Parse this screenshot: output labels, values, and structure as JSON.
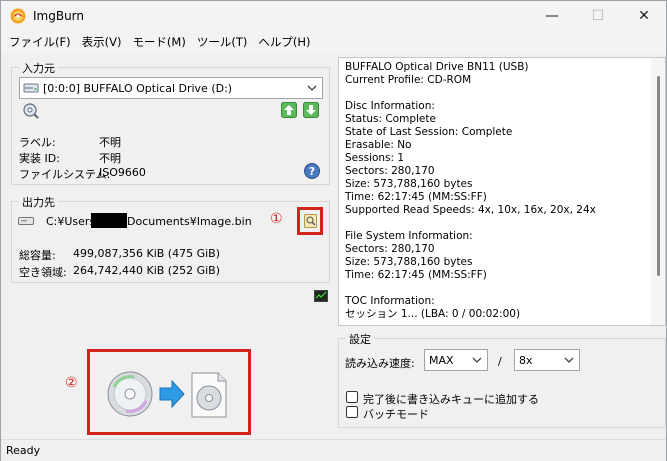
{
  "window": {
    "title": "ImgBurn"
  },
  "menu": [
    "ファイル(F)",
    "表示(V)",
    "モード(M)",
    "ツール(T)",
    "ヘルプ(H)"
  ],
  "source": {
    "group_label": "入力元",
    "drive": "[0:0:0] BUFFALO Optical Drive (D:)",
    "label_key": "ラベル:",
    "label_val": "不明",
    "volume_key": "実装 ID:",
    "volume_val": "不明",
    "fs_key": "ファイルシステム:",
    "fs_val": "ISO9660"
  },
  "dest": {
    "group_label": "出力先",
    "path_prefix": "C:¥Users",
    "path_suffix": "Documents¥Image.bin",
    "total_key": "総容量:",
    "total_val": "499,087,356 KiB  (475 GiB)",
    "free_key": "空き領域:",
    "free_val": "264,742,440 KiB  (252 GiB)"
  },
  "info_lines": [
    "BUFFALO Optical Drive BN11 (USB)",
    "Current Profile: CD-ROM",
    "",
    "Disc Information:",
    "Status: Complete",
    "State of Last Session: Complete",
    "Erasable: No",
    "Sessions: 1",
    "Sectors: 280,170",
    "Size: 573,788,160 bytes",
    "Time: 62:17:45 (MM:SS:FF)",
    "Supported Read Speeds: 4x, 10x, 16x, 20x, 24x",
    "",
    "File System Information:",
    "Sectors: 280,170",
    "Size: 573,788,160 bytes",
    "Time: 62:17:45 (MM:SS:FF)",
    "",
    "TOC Information:",
    "セッション 1... (LBA: 0 / 00:02:00)"
  ],
  "settings": {
    "group_label": "設定",
    "speed_label": "読み込み速度:",
    "speed_value": "MAX",
    "separator": "/",
    "speed2_value": "8x",
    "check_queue": "完了後に書き込みキューに追加する",
    "check_batch": "バッチモード"
  },
  "annotations": {
    "one": "①",
    "two": "②"
  },
  "status": "Ready",
  "colors": {
    "accent_red": "#d0241c",
    "panel_bg": "#f0f0f0"
  }
}
